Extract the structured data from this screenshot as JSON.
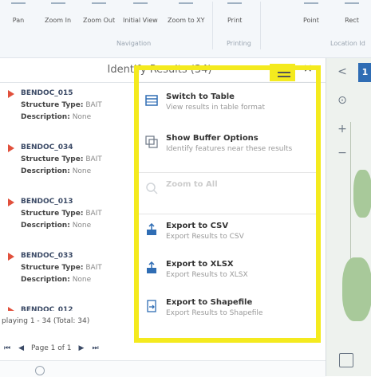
{
  "ribbon": {
    "buttons": [
      "Pan",
      "Zoom In",
      "Zoom Out",
      "Initial View",
      "Zoom to XY",
      "Print",
      "Point",
      "Rect"
    ],
    "groups": [
      "Navigation",
      "Printing",
      "Location Id"
    ]
  },
  "panel": {
    "title": "Identify Results (34)",
    "close": "×",
    "results": [
      {
        "name": "BENDOC_015",
        "type_label": "Structure Type:",
        "type_value": "BAIT",
        "desc_label": "Description:",
        "desc_value": "None"
      },
      {
        "name": "BENDOC_034",
        "type_label": "Structure Type:",
        "type_value": "BAIT",
        "desc_label": "Description:",
        "desc_value": "None"
      },
      {
        "name": "BENDOC_013",
        "type_label": "Structure Type:",
        "type_value": "BAIT",
        "desc_label": "Description:",
        "desc_value": "None"
      },
      {
        "name": "BENDOC_033",
        "type_label": "Structure Type:",
        "type_value": "BAIT",
        "desc_label": "Description:",
        "desc_value": "None"
      }
    ],
    "partial_result": "BENDOC_012",
    "display_text": "playing 1 - 34 (Total: 34)",
    "pager": {
      "page_text": "Page 1 of 1"
    }
  },
  "menu": {
    "items": [
      {
        "title": "Switch to Table",
        "desc": "View results in table format",
        "icon": "table-icon",
        "enabled": true
      },
      {
        "title": "Show Buffer Options",
        "desc": "Identify features near these results",
        "icon": "buffer-icon",
        "enabled": true
      },
      {
        "title": "Zoom to All",
        "desc": "",
        "icon": "zoom-icon",
        "enabled": false
      },
      {
        "title": "Export to CSV",
        "desc": "Export Results to CSV",
        "icon": "export-csv-icon",
        "enabled": true
      },
      {
        "title": "Export to XLSX",
        "desc": "Export Results to XLSX",
        "icon": "export-xlsx-icon",
        "enabled": true
      },
      {
        "title": "Export to Shapefile",
        "desc": "Export Results to Shapefile",
        "icon": "export-shapefile-icon",
        "enabled": true
      }
    ]
  },
  "map": {
    "tab_label": "1",
    "tools": [
      "<",
      "⊙",
      "+",
      "−"
    ]
  },
  "colors": {
    "highlight": "#f4ea1e",
    "pin": "#e1503c",
    "accent": "#2f6db4"
  }
}
